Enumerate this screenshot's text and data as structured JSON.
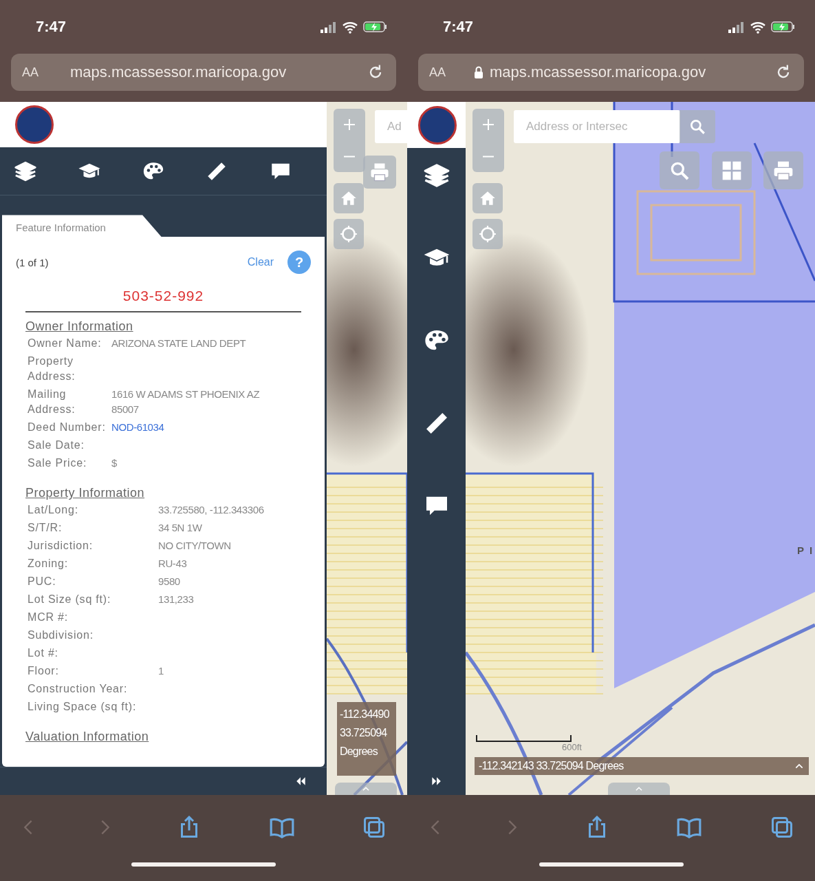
{
  "phones": [
    {
      "kind": "panel_open",
      "status_bar": {
        "time": "7:47"
      },
      "address_bar": {
        "text_size": "AA",
        "url": "maps.mcassessor.maricopa.gov",
        "secure": false
      },
      "feature_panel": {
        "tab": "Feature Information",
        "count": "(1 of 1)",
        "clear": "Clear",
        "help": "?",
        "parcel": "503-52-992",
        "sections": [
          {
            "title": "Owner Information",
            "rows": [
              {
                "label": "Owner Name:",
                "value": "ARIZONA STATE LAND DEPT"
              },
              {
                "label": "Property Address:"
              },
              {
                "label": "Mailing Address:",
                "value": "1616 W ADAMS ST PHOENIX AZ 85007"
              },
              {
                "label": "Deed Number:",
                "value": "NOD-61034",
                "kind": "link"
              },
              {
                "label": "Sale Date:"
              },
              {
                "label": "Sale Price:",
                "value": "$"
              }
            ]
          },
          {
            "title": "Property Information",
            "rows": [
              {
                "label": "Lat/Long:",
                "value": "33.725580, -112.343306"
              },
              {
                "label": "S/T/R:",
                "value": "34 5N 1W"
              },
              {
                "label": "Jurisdiction:",
                "value": "NO CITY/TOWN"
              },
              {
                "label": "Zoning:",
                "value": "RU-43"
              },
              {
                "label": "PUC:",
                "value": "9580"
              },
              {
                "label": "Lot Size (sq ft):",
                "value": "131,233"
              },
              {
                "label": "MCR #:"
              },
              {
                "label": "Subdivision:"
              },
              {
                "label": "Lot #:"
              },
              {
                "label": "Floor:",
                "value": "1"
              },
              {
                "label": "Construction Year:"
              },
              {
                "label": "Living Space (sq ft):"
              }
            ]
          },
          {
            "title": "Valuation Information"
          }
        ]
      },
      "map": {
        "search_placeholder": "Ad",
        "coordinates": "-112.34490 33.725094 Degrees"
      }
    },
    {
      "kind": "panel_collapsed",
      "status_bar": {
        "time": "7:47"
      },
      "address_bar": {
        "text_size": "AA",
        "url": "maps.mcassessor.maricopa.gov",
        "secure": true
      },
      "map": {
        "search_placeholder": "Address or Intersec",
        "coordinates": "-112.342143 33.725094 Degrees",
        "scale": "600ft",
        "edge_label": "P I"
      }
    }
  ]
}
